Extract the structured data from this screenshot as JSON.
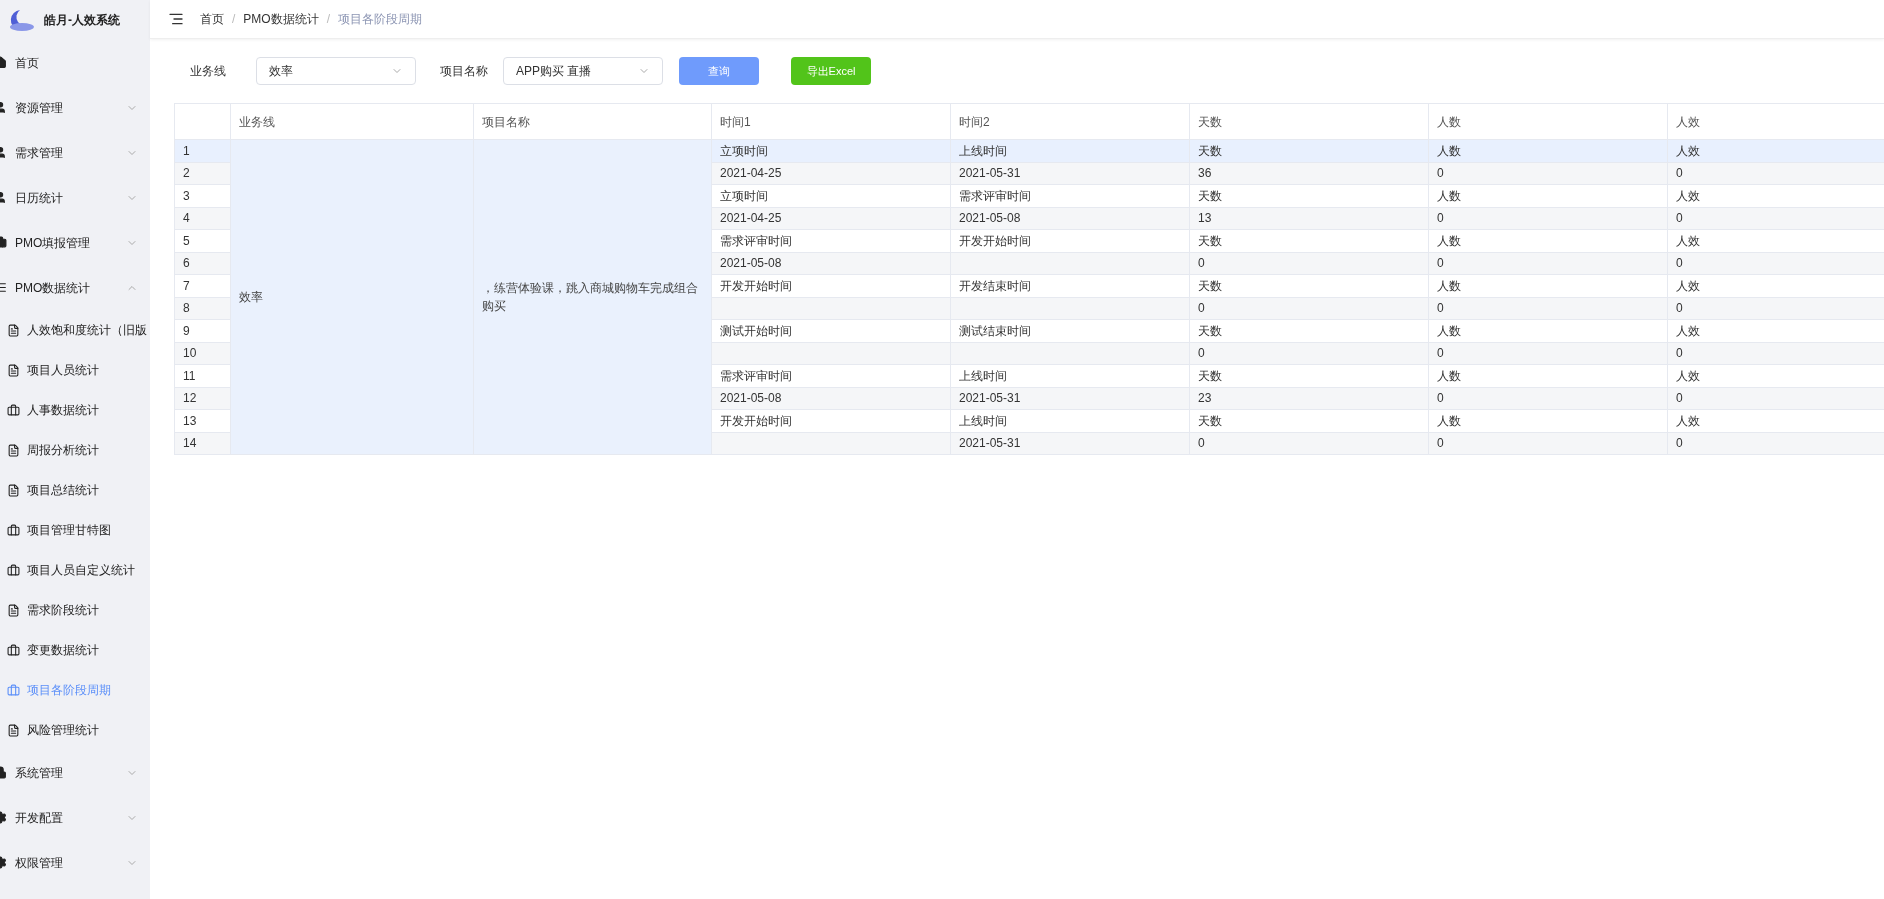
{
  "app": {
    "title": "皓月-人效系统"
  },
  "sidebar": {
    "items": [
      {
        "label": "首页",
        "kind": "link",
        "selected": false
      },
      {
        "label": "资源管理",
        "kind": "group",
        "expanded": false
      },
      {
        "label": "需求管理",
        "kind": "group",
        "expanded": false
      },
      {
        "label": "日历统计",
        "kind": "group",
        "expanded": false
      },
      {
        "label": "PMO填报管理",
        "kind": "group",
        "expanded": false
      },
      {
        "label": "PMO数据统计",
        "kind": "group",
        "expanded": true,
        "children": [
          {
            "label": "人效饱和度统计（旧版",
            "selected": false
          },
          {
            "label": "项目人员统计",
            "selected": false
          },
          {
            "label": "人事数据统计",
            "selected": false
          },
          {
            "label": "周报分析统计",
            "selected": false
          },
          {
            "label": "项目总结统计",
            "selected": false
          },
          {
            "label": "项目管理甘特图",
            "selected": false
          },
          {
            "label": "项目人员自定义统计",
            "selected": false
          },
          {
            "label": "需求阶段统计",
            "selected": false
          },
          {
            "label": "变更数据统计",
            "selected": false
          },
          {
            "label": "项目各阶段周期",
            "selected": true
          },
          {
            "label": "风险管理统计",
            "selected": false
          }
        ]
      },
      {
        "label": "系统管理",
        "kind": "group",
        "expanded": false
      },
      {
        "label": "开发配置",
        "kind": "group",
        "expanded": false
      },
      {
        "label": "权限管理",
        "kind": "group",
        "expanded": false
      }
    ]
  },
  "breadcrumb": [
    "首页",
    "PMO数据统计",
    "项目各阶段周期"
  ],
  "breadcrumb_separator": "/",
  "filters": {
    "business_line": {
      "label": "业务线",
      "value": "效率"
    },
    "project_name": {
      "label": "项目名称",
      "value": "APP购买 直播"
    },
    "query_button": "查询",
    "export_button": "导出Excel"
  },
  "table": {
    "columns": [
      "业务线",
      "项目名称",
      "时间1",
      "时间2",
      "天数",
      "人数",
      "人效"
    ],
    "rows": [
      {
        "index": "1",
        "selected": true,
        "cells": [
          {
            "text": "效率",
            "rowspan": 14
          },
          {
            "text": "，练营体验课，跳入商城购物车完成组合购买",
            "rowspan": 14
          },
          "立项时间",
          "上线时间",
          "天数",
          "人数",
          "人效"
        ]
      },
      {
        "index": "2",
        "selected": false,
        "cells": [
          "2021-04-25",
          "2021-05-31",
          "36",
          "0",
          "0"
        ]
      },
      {
        "index": "3",
        "selected": false,
        "cells": [
          "立项时间",
          "需求评审时间",
          "天数",
          "人数",
          "人效"
        ]
      },
      {
        "index": "4",
        "selected": false,
        "cells": [
          "2021-04-25",
          "2021-05-08",
          "13",
          "0",
          "0"
        ]
      },
      {
        "index": "5",
        "selected": false,
        "cells": [
          "需求评审时间",
          "开发开始时间",
          "天数",
          "人数",
          "人效"
        ]
      },
      {
        "index": "6",
        "selected": false,
        "cells": [
          "2021-05-08",
          "",
          "0",
          "0",
          "0"
        ]
      },
      {
        "index": "7",
        "selected": false,
        "cells": [
          "开发开始时间",
          "开发结束时间",
          "天数",
          "人数",
          "人效"
        ]
      },
      {
        "index": "8",
        "selected": false,
        "cells": [
          "",
          "",
          "0",
          "0",
          "0"
        ]
      },
      {
        "index": "9",
        "selected": false,
        "cells": [
          "测试开始时间",
          "测试结束时间",
          "天数",
          "人数",
          "人效"
        ]
      },
      {
        "index": "10",
        "selected": false,
        "cells": [
          "",
          "",
          "0",
          "0",
          "0"
        ]
      },
      {
        "index": "11",
        "selected": false,
        "cells": [
          "需求评审时间",
          "上线时间",
          "天数",
          "人数",
          "人效"
        ]
      },
      {
        "index": "12",
        "selected": false,
        "cells": [
          "2021-05-08",
          "2021-05-31",
          "23",
          "0",
          "0"
        ]
      },
      {
        "index": "13",
        "selected": false,
        "cells": [
          "开发开始时间",
          "上线时间",
          "天数",
          "人数",
          "人效"
        ]
      },
      {
        "index": "14",
        "selected": false,
        "cells": [
          "",
          "2021-05-31",
          "0",
          "0",
          "0"
        ]
      }
    ]
  }
}
